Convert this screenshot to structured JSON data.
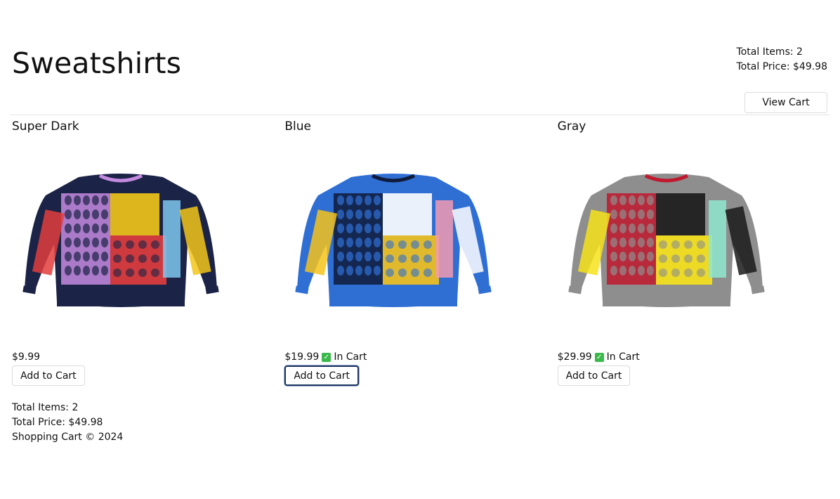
{
  "header": {
    "title": "Sweatshirts",
    "total_items": "Total Items: 2",
    "total_price": "Total Price: $49.98",
    "view_cart_label": "View Cart"
  },
  "products": [
    {
      "name": "Super Dark",
      "price": "$9.99",
      "in_cart": false,
      "in_cart_label": "",
      "button_label": "Add to Cart",
      "colors": {
        "base": "#1b2346",
        "accent1": "#f3c61a",
        "accent2": "#c48ae0",
        "accent3": "#e23d3d",
        "accent4": "#7ec8f0"
      }
    },
    {
      "name": "Blue",
      "price": "$19.99",
      "in_cart": true,
      "in_cart_label": "In Cart",
      "button_label": "Add to Cart",
      "colors": {
        "base": "#2f6fd4",
        "accent1": "#ffffff",
        "accent2": "#0f1b3a",
        "accent3": "#f4c21a",
        "accent4": "#f29bb0"
      }
    },
    {
      "name": "Gray",
      "price": "$29.99",
      "in_cart": true,
      "in_cart_label": "In Cart",
      "button_label": "Add to Cart",
      "colors": {
        "base": "#8e8e8e",
        "accent1": "#1a1a1a",
        "accent2": "#c0182d",
        "accent3": "#f6e21a",
        "accent4": "#8ee8cf"
      }
    }
  ],
  "footer": {
    "total_items": "Total Items: 2",
    "total_price": "Total Price: $49.98",
    "copyright": "Shopping Cart © 2024"
  }
}
